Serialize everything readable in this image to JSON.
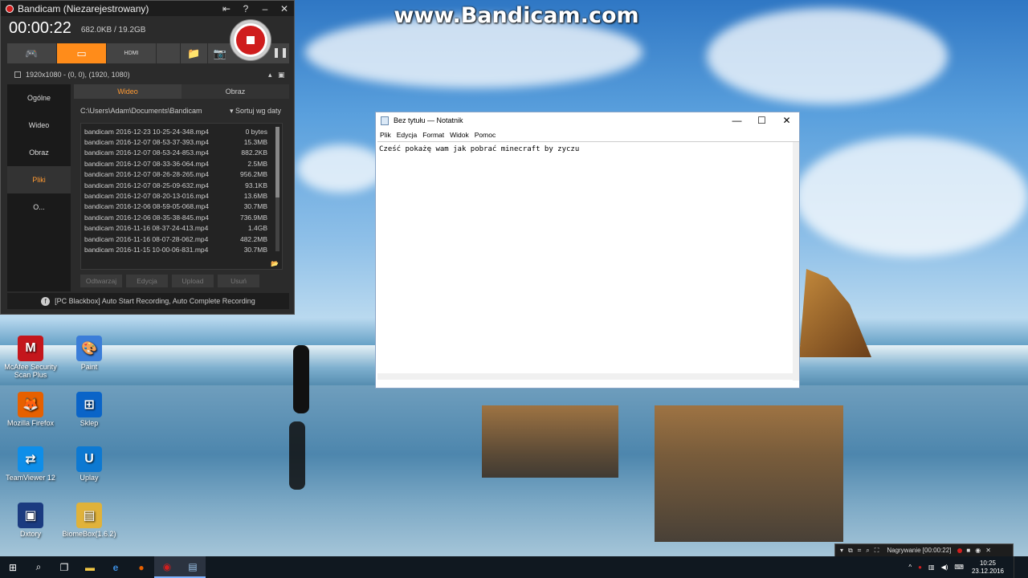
{
  "watermark": "www.Bandicam.com",
  "bandicam": {
    "title": "Bandicam (Niezarejestrowany)",
    "timer": "00:00:22",
    "size": "682.0KB / 19.2GB",
    "resolution": "1920x1080 - (0, 0), (1920, 1080)",
    "sidebar": [
      "Ogólne",
      "Wideo",
      "Obraz",
      "Pliki",
      "O..."
    ],
    "active_sidebar": "Pliki",
    "tabs": [
      "Wideo",
      "Obraz"
    ],
    "path": "C:\\Users\\Adam\\Documents\\Bandicam",
    "sort": "▾ Sortuj wg daty",
    "files": [
      {
        "name": "bandicam 2016-12-23 10-25-24-348.mp4",
        "size": "0 bytes"
      },
      {
        "name": "bandicam 2016-12-07 08-53-37-393.mp4",
        "size": "15.3MB"
      },
      {
        "name": "bandicam 2016-12-07 08-53-24-853.mp4",
        "size": "882.2KB"
      },
      {
        "name": "bandicam 2016-12-07 08-33-36-064.mp4",
        "size": "2.5MB"
      },
      {
        "name": "bandicam 2016-12-07 08-26-28-265.mp4",
        "size": "956.2MB"
      },
      {
        "name": "bandicam 2016-12-07 08-25-09-632.mp4",
        "size": "93.1KB"
      },
      {
        "name": "bandicam 2016-12-07 08-20-13-016.mp4",
        "size": "13.6MB"
      },
      {
        "name": "bandicam 2016-12-06 08-59-05-068.mp4",
        "size": "30.7MB"
      },
      {
        "name": "bandicam 2016-12-06 08-35-38-845.mp4",
        "size": "736.9MB"
      },
      {
        "name": "bandicam 2016-11-16 08-37-24-413.mp4",
        "size": "1.4GB"
      },
      {
        "name": "bandicam 2016-11-16 08-07-28-062.mp4",
        "size": "482.2MB"
      },
      {
        "name": "bandicam 2016-11-15 10-00-06-831.mp4",
        "size": "30.7MB"
      }
    ],
    "actions": [
      "Odtwarzaj",
      "Edycja",
      "Upload",
      "Usuń"
    ],
    "footer": "[PC Blackbox] Auto Start Recording, Auto Complete Recording",
    "toolbar_hdmi": "HDMI"
  },
  "desktop_icons": [
    {
      "label": "McAfee Security Scan Plus",
      "glyph": "M",
      "color": "#c4161c"
    },
    {
      "label": "Paint",
      "glyph": "🎨",
      "color": "#3b7dd8"
    },
    {
      "label": "Mozilla Firefox",
      "glyph": "🦊",
      "color": "#e66000"
    },
    {
      "label": "Sklep",
      "glyph": "⊞",
      "color": "#0a64c8"
    },
    {
      "label": "TeamViewer 12",
      "glyph": "⇄",
      "color": "#0e8ee9"
    },
    {
      "label": "Uplay",
      "glyph": "U",
      "color": "#0d79d2"
    },
    {
      "label": "Dxtory",
      "glyph": "▣",
      "color": "#1b3b80"
    },
    {
      "label": "BiomeBox(1.6.2)",
      "glyph": "▤",
      "color": "#e0b23a"
    }
  ],
  "notepad": {
    "title": "Bez tytułu — Notatnik",
    "menu": [
      "Plik",
      "Edycja",
      "Format",
      "Widok",
      "Pomoc"
    ],
    "content": "Cześć pokażę wam jak pobrać minecraft by zyczu"
  },
  "bandicam_mini": {
    "status": "Nagrywanie [00:00:22]"
  },
  "taskbar": {
    "time": "10:25",
    "date": "23.12.2016"
  }
}
